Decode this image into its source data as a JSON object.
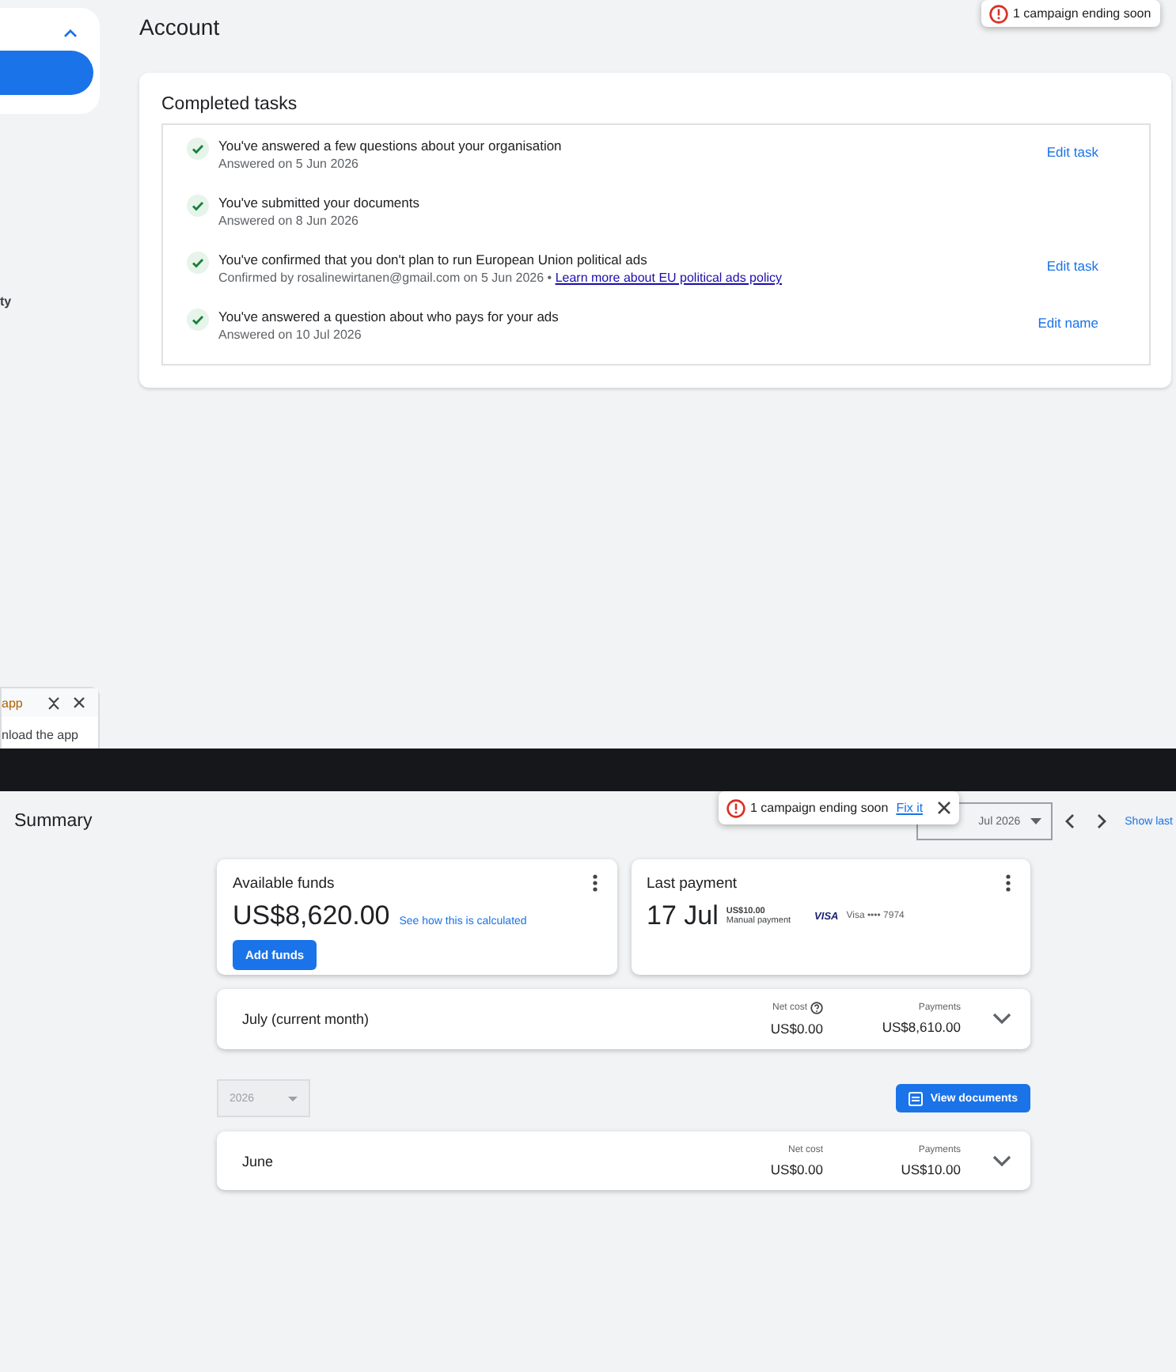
{
  "account_screen": {
    "sidebar": {
      "section_expanded": true,
      "partial_label": "ty",
      "app_panel": {
        "title": "app",
        "body": "nload the app"
      }
    },
    "title": "Account",
    "toast": {
      "message": "1 campaign ending soon"
    },
    "completed_tasks": {
      "title": "Completed tasks",
      "tasks": [
        {
          "title": "You've answered a few questions about your organisation",
          "detail": "Answered on 5 Jun 2026",
          "action": "Edit task"
        },
        {
          "title": "You've submitted your documents",
          "detail": "Answered on 8 Jun 2026"
        },
        {
          "title": "You've confirmed that you don't plan to run European Union political ads",
          "detail": "Confirmed by rosalinewirtanen@gmail.com on 5 Jun 2026 • ",
          "link": "Learn more about EU political ads policy",
          "action": "Edit task"
        },
        {
          "title": "You've answered a question about who pays for your ads",
          "detail": "Answered on 10 Jul 2026",
          "action": "Edit name"
        }
      ]
    }
  },
  "summary_screen": {
    "title": "Summary",
    "toast": {
      "message": "1 campaign ending soon",
      "link": "Fix it"
    },
    "date_range": {
      "value": "Jul 2026"
    },
    "show_last": "Show last",
    "available_funds": {
      "title": "Available funds",
      "amount": "US$8,620.00",
      "link": "See how this is calculated",
      "button": "Add funds"
    },
    "last_payment": {
      "title": "Last payment",
      "date": "17 Jul",
      "amount": "US$10.00",
      "method": "Manual payment",
      "card_brand": "VISA",
      "card": "Visa •••• 7974"
    },
    "current_month": {
      "label": "July (current month)",
      "net_cost_label": "Net cost",
      "net_cost": "US$0.00",
      "payments_label": "Payments",
      "payments": "US$8,610.00"
    },
    "year_select": {
      "value": "2026",
      "disabled": true
    },
    "view_documents": "View documents",
    "months": [
      {
        "label": "June",
        "net_cost_label": "Net cost",
        "net_cost": "US$0.00",
        "payments_label": "Payments",
        "payments": "US$10.00"
      }
    ]
  }
}
